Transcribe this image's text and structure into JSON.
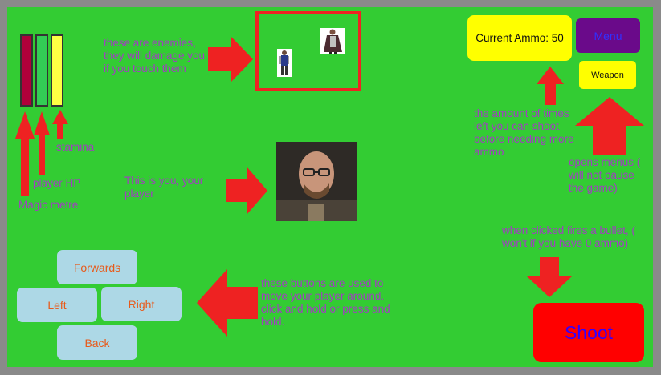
{
  "bars": {
    "magic_color": "#b0003a",
    "hp_color": "#33cc55",
    "stamina_color": "#ffff44"
  },
  "notes": {
    "enemies": "these are enemies, they will damage you if you touch them",
    "stamina": "stamina",
    "player_hp": "player HP",
    "magic": "Magic metre",
    "player": "This is you, your player",
    "ammo": "the amount of times left you can shoot before needing more ammo",
    "menus": "opens menus ( will not pause the game)",
    "shoot": "when clicked fires a bullet, ( won't if you have 0 ammo)",
    "movement": "these buttons are used to move your player around. click and hold or press and hold."
  },
  "hud": {
    "ammo_label": "Current Ammo: 50",
    "menu_label": "Menu",
    "weapon_label": "Weapon",
    "shoot_label": "Shoot"
  },
  "controls": {
    "forwards": "Forwards",
    "left": "Left",
    "right": "Right",
    "back": "Back"
  },
  "colors": {
    "background": "#33cc33",
    "note_text": "#a040c0",
    "arrow": "#ee2222",
    "ammo_box": "#ffff00",
    "menu_box": "#6a0a8a",
    "shoot_box": "#ff0000",
    "shoot_text": "#3300ff",
    "dpad_button": "#add8e6",
    "dpad_text": "#e85a1a"
  },
  "icons": {
    "enemy": "enemy-sprite-icon",
    "player": "player-portrait"
  }
}
